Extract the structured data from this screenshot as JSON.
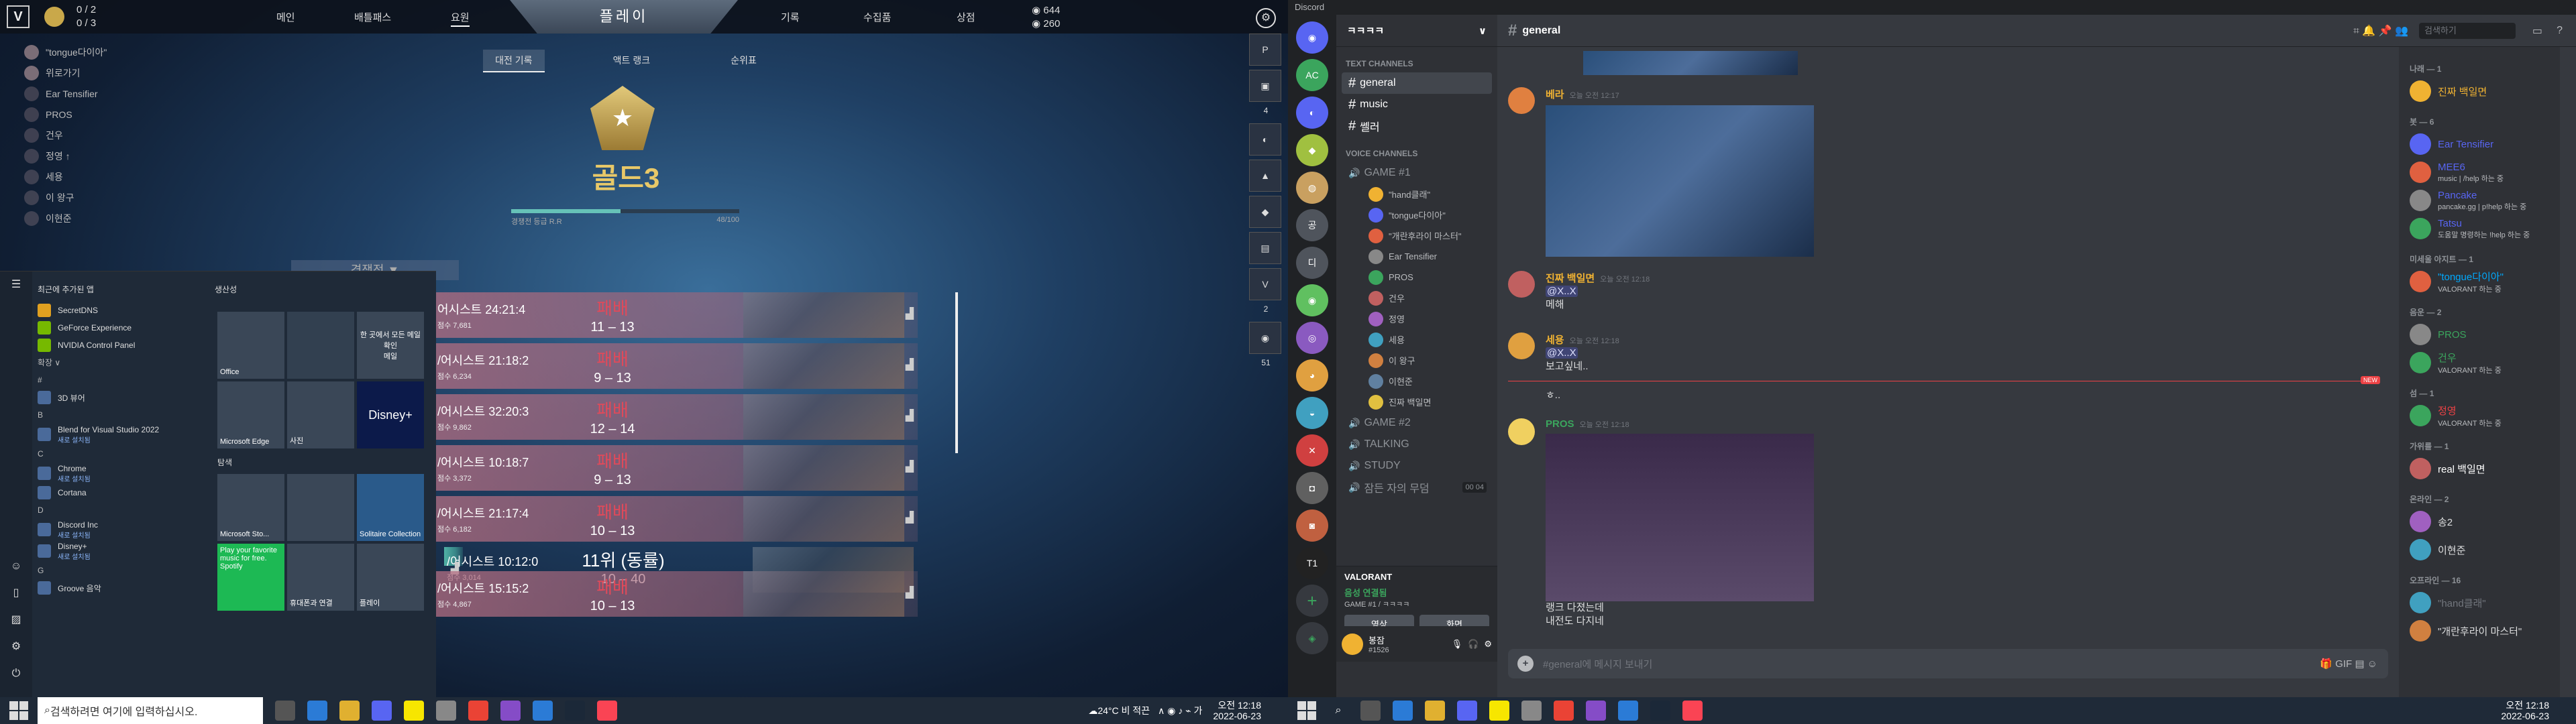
{
  "valorant": {
    "counters": {
      "a": "0 / 2",
      "b": "0 / 3"
    },
    "nav": [
      "메인",
      "배틀패스",
      "요원",
      "플레이",
      "기록",
      "수집품",
      "상점"
    ],
    "currency": {
      "vp": "644",
      "rp": "260"
    },
    "party": {
      "members": [
        "\"tongue다이아\"",
        "위로가기",
        "Ear Tensifier",
        "PROS",
        "건우",
        "정영 ↑",
        "세용",
        "이 왕구",
        "이현준"
      ],
      "note": "\"hand클래\""
    },
    "career_tabs": [
      "대전 기록",
      "액트 랭크",
      "순위표"
    ],
    "rank": {
      "name": "골드3",
      "rr": 48,
      "rr_max": 100,
      "label_left": "경쟁전 등급 R.R",
      "label_right": "48/100"
    },
    "mode": "경쟁전",
    "matches": [
      {
        "agent": "어시스트",
        "time": "24:21:4",
        "sub": "점수 7,681",
        "result": "패배",
        "score": "11 – 13",
        "win": false
      },
      {
        "agent": "/어시스트",
        "time": "21:18:2",
        "sub": "점수 6,234",
        "result": "패배",
        "score": "9 – 13",
        "win": false
      },
      {
        "agent": "/어시스트",
        "time": "32:20:3",
        "sub": "점수 9,862",
        "result": "패배",
        "score": "12 – 14",
        "win": false
      },
      {
        "agent": "/어시스트",
        "time": "10:18:7",
        "sub": "점수 3,372",
        "result": "패배",
        "score": "9 – 13",
        "win": false
      },
      {
        "agent": "/어시스트",
        "time": "21:17:4",
        "sub": "점수 6,182",
        "result": "패배",
        "score": "10 – 13",
        "win": false
      },
      {
        "agent": "/어시스트",
        "time": "10:12:0",
        "sub": "점수 3,014",
        "result": "11위 (동률)",
        "score": "10 – 40",
        "win": true
      },
      {
        "agent": "/어시스트",
        "time": "15:15:2",
        "sub": "점수 4,867",
        "result": "패배",
        "score": "10 – 13",
        "win": false
      }
    ],
    "dock": [
      "2",
      "+2",
      "51"
    ]
  },
  "start_menu": {
    "recent_header": "최근에 추가된 앱",
    "recent": [
      "SecretDNS",
      "GeForce Experience",
      "NVIDIA Control Panel"
    ],
    "expand": "확장 ∨",
    "apps": [
      {
        "letter": "#",
        "name": "3D 뷰어",
        "sub": ""
      },
      {
        "letter": "B",
        "name": "Blend for Visual Studio 2022",
        "sub": "새로 설치됨"
      },
      {
        "letter": "C",
        "name": "Chrome",
        "sub": "새로 설치됨"
      },
      {
        "letter": "",
        "name": "Cortana",
        "sub": ""
      },
      {
        "letter": "D",
        "name": "Discord Inc",
        "sub": "새로 설치됨"
      },
      {
        "letter": "",
        "name": "Disney+",
        "sub": "새로 설치됨"
      },
      {
        "letter": "G",
        "name": "Groove 음악",
        "sub": ""
      }
    ],
    "groups": [
      "생산성",
      "탐색"
    ],
    "tiles": [
      "Office",
      "한 곳에서 모든 메일 확인",
      "메일",
      "Microsoft Edge",
      "사진",
      "Disney+",
      "Microsoft Sto...",
      "Solitaire Collection",
      "Play your favorite music for free.",
      "Spotify",
      "휴대폰과 연결",
      "플레이"
    ]
  },
  "taskbar": {
    "search": "검색하려면 여기에 입력하십시오.",
    "weather": "24°C 비 적끈",
    "time": "오전 12:18",
    "date": "2022-06-23"
  },
  "discord": {
    "title": "Discord",
    "server": "ㅋㅋㅋㅋ",
    "categories": {
      "text": "TEXT CHANNELS",
      "voice": "VOICE CHANNELS"
    },
    "text_channels": [
      "general",
      "music",
      "쎌러"
    ],
    "voice_channels": [
      {
        "name": "GAME #1",
        "users": [
          "\"hand클래\"",
          "\"tongue다이아\"",
          "\"개란후라이 마스터\"",
          "Ear Tensifier",
          "PROS",
          "건우",
          "정영",
          "세용",
          "이 왕구",
          "이현준",
          "진짜 백일면"
        ]
      },
      {
        "name": "GAME #2",
        "users": []
      },
      {
        "name": "TALKING",
        "users": []
      },
      {
        "name": "STUDY",
        "users": []
      },
      {
        "name": "잠든 자의 무덤",
        "users": []
      }
    ],
    "timer": "00  04",
    "game_activity": "VALORANT",
    "voice_status": "음성 연결됨",
    "voice_sub": "GAME #1 / ㅋㅋㅋㅋ",
    "voice_btn_video": "영상",
    "voice_btn_screen": "화면",
    "user": {
      "name": "봉잠",
      "tag": "#1526"
    },
    "channel_header": "general",
    "header_search": "검색하기",
    "messages": [
      {
        "name": "베라",
        "time": "오늘 오전 12:17",
        "text": "",
        "color": "#f0b232"
      },
      {
        "name": "진짜 백일면",
        "time": "오늘 오전 12:18",
        "mention": "@X..X",
        "text": "메해",
        "color": "#f0b232"
      },
      {
        "name": "세용",
        "time": "오늘 오전 12:18",
        "mention": "@X..X",
        "text": "보고싶네..",
        "extra": "ㅎ..",
        "color": "#f0b232"
      },
      {
        "name": "PROS",
        "time": "오늘 오전 12:18",
        "text": "랭크 다졌는데",
        "extra": "내전도 다지네",
        "color": "#3ba55d"
      }
    ],
    "new_label": "NEW",
    "input_placeholder": "#general에 메시지 보내기",
    "member_groups": [
      {
        "title": "나래 — 1",
        "members": [
          {
            "name": "진짜 백일면",
            "status": "",
            "color": "#f0b232"
          }
        ]
      },
      {
        "title": "봇 — 6",
        "members": [
          {
            "name": "Ear Tensifier",
            "status": "",
            "color": "#5865f2"
          },
          {
            "name": "MEE6",
            "status": "music | /help 하는 중",
            "color": "#5865f2"
          },
          {
            "name": "Pancake",
            "status": "pancake.gg | p!help 하는 중",
            "color": "#5865f2"
          },
          {
            "name": "Tatsu",
            "status": "도움말 명령하는 !help 하는 중",
            "color": "#5865f2"
          }
        ]
      },
      {
        "title": "미세울 아지트 — 1",
        "members": [
          {
            "name": "\"tongue다이아\"",
            "status": "VALORANT 하는 중",
            "color": "#00a8fc"
          }
        ]
      },
      {
        "title": "음운 — 2",
        "members": [
          {
            "name": "PROS",
            "status": "",
            "color": "#3ba55d"
          },
          {
            "name": "건우",
            "status": "VALORANT 하는 중",
            "color": "#3ba55d"
          }
        ]
      },
      {
        "title": "섬 — 1",
        "members": [
          {
            "name": "정영",
            "status": "VALORANT 하는 중",
            "color": "#ed4245"
          }
        ]
      },
      {
        "title": "가위를 — 1",
        "members": [
          {
            "name": "real 백일면",
            "status": "",
            "color": "#fff"
          }
        ]
      },
      {
        "title": "온라인 — 2",
        "members": [
          {
            "name": "송2",
            "status": "",
            "color": "#dcddde"
          },
          {
            "name": "이현준",
            "status": "",
            "color": "#dcddde"
          }
        ]
      },
      {
        "title": "오프라인 — 16",
        "members": [
          {
            "name": "\"hand클래\"",
            "status": "",
            "color": "#72767d"
          },
          {
            "name": "\"개란후라이 마스터\"",
            "status": "",
            "color": "#dcddde"
          }
        ]
      }
    ],
    "taskbar": {
      "time": "오전 12:18",
      "date": "2022-06-23"
    }
  }
}
